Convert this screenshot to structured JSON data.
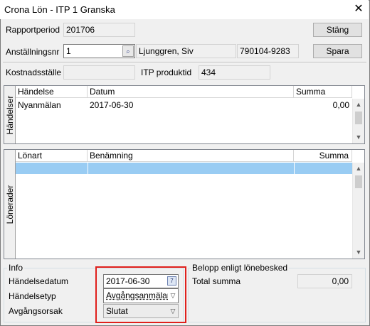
{
  "window": {
    "title": "Crona Lön - ITP 1 Granska"
  },
  "header": {
    "rapportperiod_label": "Rapportperiod",
    "rapportperiod_value": "201706",
    "stang_button": "Stäng",
    "anstallningsnr_label": "Anställningsnr",
    "anstallningsnr_value": "1",
    "employee_name": "Ljunggren, Siv",
    "personnummer": "790104-9283",
    "spara_button": "Spara",
    "kostnadsstalle_label": "Kostnadsställe",
    "kostnadsstalle_value": "",
    "itp_produktid_label": "ITP produktid",
    "itp_produktid_value": "434"
  },
  "handelser": {
    "side_label": "Händelser",
    "columns": [
      "Händelse",
      "Datum",
      "Summa"
    ],
    "rows": [
      {
        "handelse": "Nyanmälan",
        "datum": "2017-06-30",
        "summa": "0,00"
      }
    ]
  },
  "lonerader": {
    "side_label": "Lönerader",
    "columns": [
      "Lönart",
      "Benämning",
      "Summa"
    ],
    "rows": []
  },
  "info": {
    "group_label": "Info",
    "handelsedatum_label": "Händelsedatum",
    "handelsedatum_value": "2017-06-30",
    "handelsetyp_label": "Händelsetyp",
    "handelsetyp_value": "Avgångsanmälan",
    "avgangsorsak_label": "Avgångsorsak",
    "avgangsorsak_value": "Slutat"
  },
  "belopp": {
    "group_label": "Belopp enligt lönebesked",
    "total_label": "Total summa",
    "total_value": "0,00"
  },
  "colors": {
    "selection": "#99ccf3",
    "highlight_box": "#e0201c"
  }
}
